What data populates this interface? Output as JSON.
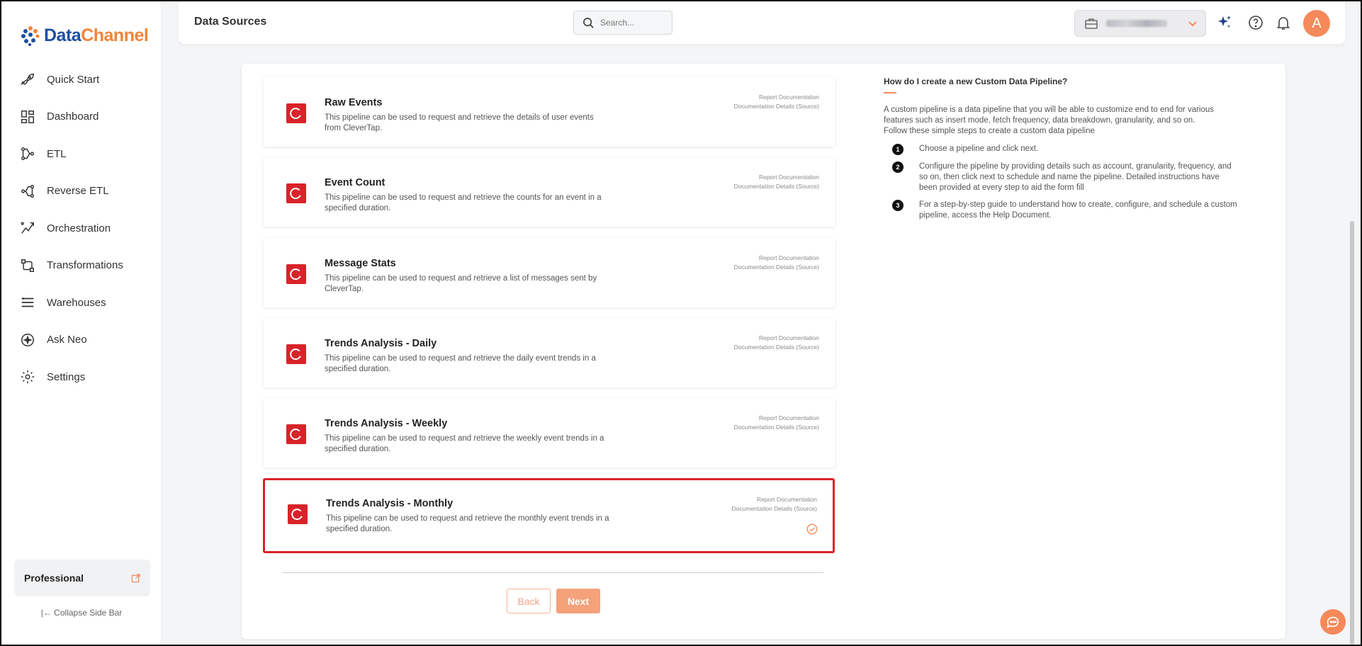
{
  "brand": {
    "part1": "Data",
    "part2": "Channel"
  },
  "sidebar": {
    "items": [
      {
        "label": "Quick Start",
        "icon": "rocket-icon"
      },
      {
        "label": "Dashboard",
        "icon": "dashboard-icon"
      },
      {
        "label": "ETL",
        "icon": "etl-icon"
      },
      {
        "label": "Reverse ETL",
        "icon": "reverse-etl-icon"
      },
      {
        "label": "Orchestration",
        "icon": "orchestration-icon"
      },
      {
        "label": "Transformations",
        "icon": "transformations-icon"
      },
      {
        "label": "Warehouses",
        "icon": "warehouses-icon"
      },
      {
        "label": "Ask Neo",
        "icon": "sparkle-icon"
      },
      {
        "label": "Settings",
        "icon": "gear-icon"
      }
    ],
    "plan": "Professional",
    "collapse": "|← Collapse Side Bar"
  },
  "header": {
    "title": "Data Sources",
    "search_placeholder": "Search...",
    "avatar_initial": "A"
  },
  "pipelines": [
    {
      "title": "Raw Events",
      "desc": "This pipeline can be used to request and retrieve the details of user events from CleverTap.",
      "link1": "Report Documentation",
      "link2": "Documentation Details (Source)",
      "selected": false
    },
    {
      "title": "Event Count",
      "desc": "This pipeline can be used to request and retrieve the counts for an event in a specified duration.",
      "link1": "Report Documentation",
      "link2": "Documentation Details (Source)",
      "selected": false
    },
    {
      "title": "Message Stats",
      "desc": "This pipeline can be used to request and retrieve a list of messages sent by CleverTap.",
      "link1": "Report Documentation",
      "link2": "Documentation Details (Source)",
      "selected": false
    },
    {
      "title": "Trends Analysis - Daily",
      "desc": "This pipeline can be used to request and retrieve the daily event trends in a specified duration.",
      "link1": "Report Documentation",
      "link2": "Documentation Details (Source)",
      "selected": false
    },
    {
      "title": "Trends Analysis - Weekly",
      "desc": "This pipeline can be used to request and retrieve the weekly event trends in a specified duration.",
      "link1": "Report Documentation",
      "link2": "Documentation Details (Source)",
      "selected": false
    },
    {
      "title": "Trends Analysis - Monthly",
      "desc": "This pipeline can be used to request and retrieve the monthly event trends in a specified duration.",
      "link1": "Report Documentation",
      "link2": "Documentation Details (Source)",
      "selected": true
    }
  ],
  "buttons": {
    "back": "Back",
    "next": "Next"
  },
  "help": {
    "title": "How do I create a new Custom Data Pipeline?",
    "intro": "A custom pipeline is a data pipeline that you will be able to customize end to end for various features such as insert mode, fetch frequency, data breakdown, granularity, and so on.",
    "sub": "Follow these simple steps to create a custom data pipeline",
    "steps": [
      {
        "num": "1",
        "text": "Choose a pipeline and click next."
      },
      {
        "num": "2",
        "text": "Configure the pipeline by providing details such as account, granularity, frequency, and so on, then click next to schedule and name the pipeline. Detailed instructions have been provided at every step to aid the form fill"
      },
      {
        "num": "3",
        "text": "For a step-by-step guide to understand how to create, configure, and schedule a custom pipeline, access the Help Document."
      }
    ]
  },
  "colors": {
    "accent": "#f5895a",
    "brand_blue": "#1f4fa0",
    "clevertap_red": "#d9232a"
  }
}
